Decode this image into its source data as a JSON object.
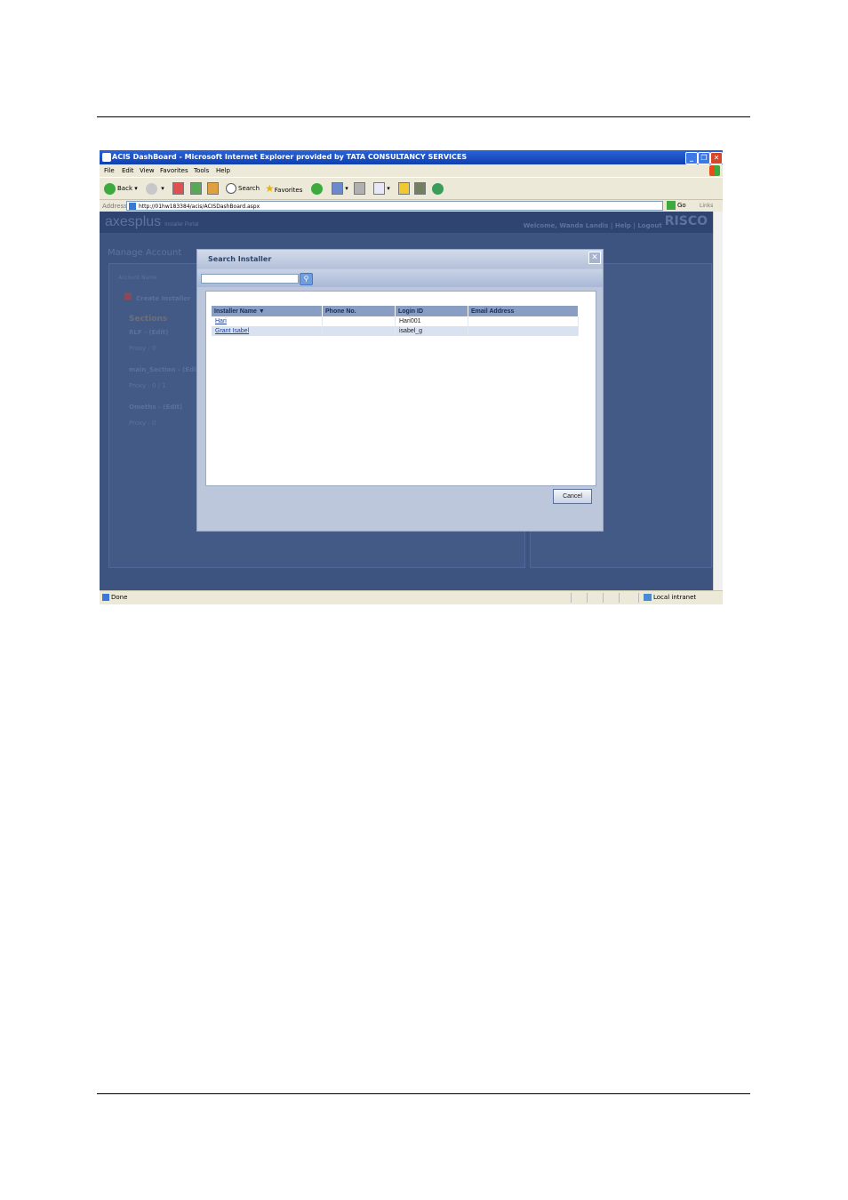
{
  "browser": {
    "window_title": "ACIS DashBoard - Microsoft Internet Explorer provided by TATA CONSULTANCY SERVICES",
    "menu": [
      "File",
      "Edit",
      "View",
      "Favorites",
      "Tools",
      "Help"
    ],
    "toolbar": {
      "back": "Back",
      "search": "Search",
      "favorites": "Favorites"
    },
    "address_label": "Address",
    "url": "http://01hw183384/acis/ACISDashBoard.aspx",
    "go": "Go",
    "links": "Links",
    "status": "Done",
    "zone": "Local intranet"
  },
  "app": {
    "logo": "axesplus",
    "logo_sub": "Installer Portal",
    "header_links": "Welcome, Wanda Landis | Help | Logout",
    "brand": "RISCO",
    "page_title": "Manage Account",
    "account_name_label": "Account Name",
    "create_installer": "Create Installer",
    "sections_label": "Sections",
    "items": [
      {
        "name": "RLF - (Edit)",
        "sub": "Proxy : 0"
      },
      {
        "name": "main_Section - (Edit)",
        "sub": "Proxy : 0 / 1"
      },
      {
        "name": "Omeths - (Edit)",
        "sub": "Proxy : 0"
      }
    ]
  },
  "dialog": {
    "title": "Search Installer",
    "columns": [
      "Installer Name",
      "Phone No.",
      "Login ID",
      "Email Address"
    ],
    "rows": [
      {
        "name": "Hari",
        "phone": "",
        "login": "Hari001",
        "email": ""
      },
      {
        "name": "Grant Isabel",
        "phone": "",
        "login": "isabel_g",
        "email": ""
      }
    ],
    "cancel": "Cancel"
  }
}
